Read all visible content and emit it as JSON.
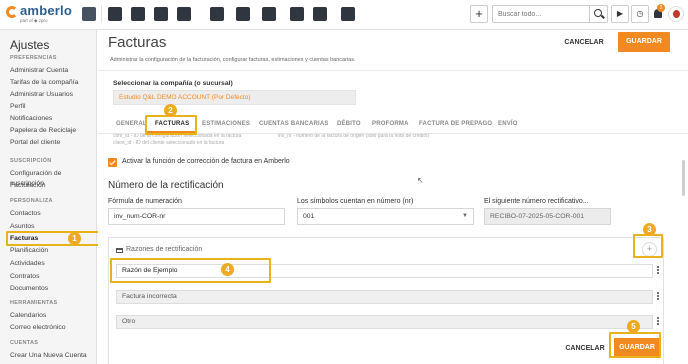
{
  "app": {
    "brand": "amberlo",
    "brand_sub": "part of ◆ zpro",
    "search_placeholder": "Buscar todo...",
    "plus_label": "+",
    "play_label": "▶",
    "timer_label": "◷",
    "notif_count": "2"
  },
  "sidebar": {
    "title": "Ajustes",
    "groups": [
      {
        "heading": "PREFERENCIAS",
        "items": [
          "Administrar Cuenta",
          "Tarifas de la compañía",
          "Administrar Usuarios",
          "Perfil",
          "Notificaciones",
          "Papelera de Reciclaje",
          "Portal del cliente"
        ]
      },
      {
        "heading": "SUSCRIPCIÓN",
        "items": [
          "Configuración de suscripción",
          "Facturación"
        ]
      },
      {
        "heading": "PERSONALIZA",
        "items": [
          "Contactos",
          "Asuntos",
          "Facturas",
          "Planificación",
          "Actividades",
          "Contratos",
          "Documentos"
        ]
      },
      {
        "heading": "HERRAMIENTAS",
        "items": [
          "Calendarios",
          "Correo electrónico"
        ]
      },
      {
        "heading": "CUENTAS",
        "items": [
          "Crear Una Nueva Cuenta"
        ]
      }
    ],
    "active_item": "Facturas"
  },
  "header": {
    "title": "Facturas",
    "description": "Administrar la configuración de la facturación, configurar facturas, estimaciones y cuentas bancarias.",
    "cancel_label": "CANCELAR",
    "save_label": "GUARDAR"
  },
  "company": {
    "label": "Seleccionar la compañía (o sucursal)",
    "value": "Estudio Q&L DEMO ACCOUNT (Por Defecto)"
  },
  "tabs": [
    "GENERAL",
    "FACTURAS",
    "ESTIMACIONES",
    "CUENTAS BANCARIAS",
    "DÉBITO",
    "PROFORMA",
    "FACTURA DE PREPAGO",
    "ENVÍO"
  ],
  "active_tab": "FACTURAS",
  "ghost_text": {
    "line1": "conf_id - ID de la configuración seleccionada en la factura",
    "line2": "client_id - ID del cliente seleccionado en la factura",
    "line3": "inv_nr - número de la factura de origen (solo para la nota de crédito)"
  },
  "correction": {
    "checkbox_label": "Activar la función de corrección de factura en Amberlo",
    "checked": true,
    "section_title": "Número de la rectificación",
    "format_label": "Fórmula de numeración",
    "format_value": "inv_num-COR-nr",
    "digits_label": "Los símbolos cuentan en número (nr)",
    "digits_value": "001",
    "next_label": "El siguiente número rectificativo...",
    "next_value": "RECIBO-07-2025-05-COR-001"
  },
  "reasons": {
    "title": "Razones de rectificación",
    "add_label": "+",
    "items": [
      "Razón de Ejemplo",
      "Factura incorrecta",
      "Otro"
    ]
  },
  "footer": {
    "cancel_label": "CANCELAR",
    "save_label": "GUARDAR"
  },
  "callouts": [
    "1",
    "2",
    "3",
    "4",
    "5"
  ],
  "colors": {
    "accent": "#f28a21",
    "callout": "#f0a922",
    "highlight": "#e8b21b",
    "brand": "#2e5f8c"
  }
}
